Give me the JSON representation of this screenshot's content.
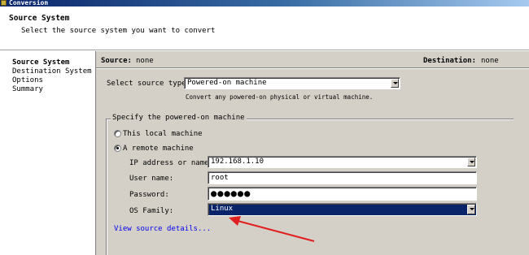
{
  "window": {
    "title": "Conversion"
  },
  "header": {
    "title": "Source System",
    "subtitle": "Select the source system you want to convert"
  },
  "nav": {
    "items": [
      {
        "label": "Source System",
        "active": true
      },
      {
        "label": "Destination System",
        "active": false
      },
      {
        "label": "Options",
        "active": false
      },
      {
        "label": "Summary",
        "active": false
      }
    ]
  },
  "info": {
    "source_label": "Source:",
    "source_value": "none",
    "destination_label": "Destination:",
    "destination_value": "none"
  },
  "source_type": {
    "label": "Select source type:",
    "value": "Powered-on machine",
    "hint": "Convert any powered-on physical or virtual machine."
  },
  "group": {
    "legend": "Specify the powered-on machine",
    "radio_local": "This local machine",
    "radio_remote": "A remote machine",
    "selected": "remote"
  },
  "fields": {
    "ip_label": "IP address or name:",
    "ip_value": "192.168.1.10",
    "user_label": "User name:",
    "user_value": "root",
    "password_label": "Password:",
    "password_value": "●●●●●●",
    "os_label": "OS Family:",
    "os_value": "Linux"
  },
  "link": {
    "label": "View source details..."
  },
  "annotation": {
    "color": "#e02020"
  }
}
